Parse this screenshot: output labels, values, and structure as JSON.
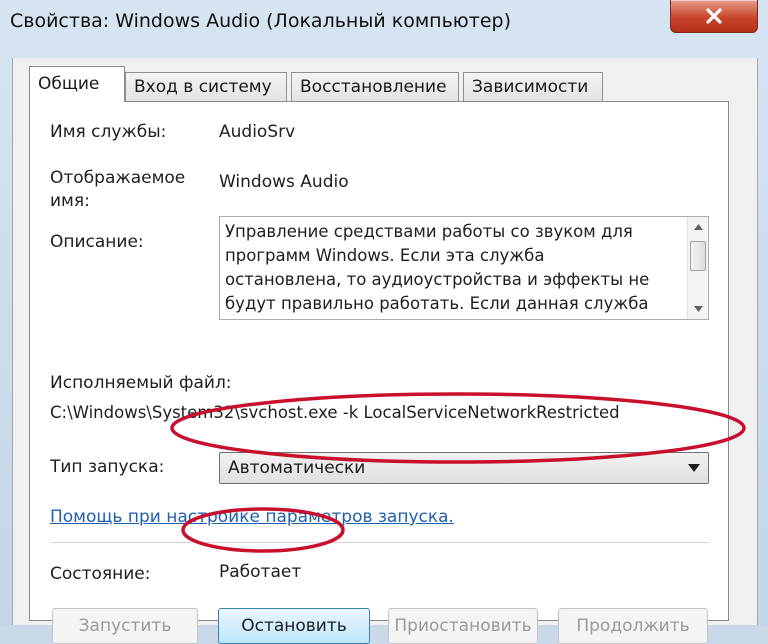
{
  "window": {
    "title": "Свойства: Windows Audio (Локальный компьютер)"
  },
  "tabs": [
    {
      "label": "Общие",
      "active": true
    },
    {
      "label": "Вход в систему",
      "active": false
    },
    {
      "label": "Восстановление",
      "active": false
    },
    {
      "label": "Зависимости",
      "active": false
    }
  ],
  "general": {
    "service_name_label": "Имя службы:",
    "service_name_value": "AudioSrv",
    "display_name_label_line1": "Отображаемое",
    "display_name_label_line2": "имя:",
    "display_name_value": "Windows Audio",
    "description_label": "Описание:",
    "description_lines": [
      "Управление средствами работы со звуком для",
      "программ Windows.  Если эта служба",
      "остановлена, то аудиоустройства и эффекты не",
      "будут правильно работать.  Если данная служба"
    ],
    "executable_label": "Исполняемый файл:",
    "executable_value": "C:\\Windows\\System32\\svchost.exe -k LocalServiceNetworkRestricted",
    "startup_type_label": "Тип запуска:",
    "startup_type_value": "Автоматически",
    "help_link": "Помощь при настройке параметров запуска.",
    "status_label": "Состояние:",
    "status_value": "Работает"
  },
  "buttons": {
    "start": "Запустить",
    "stop": "Остановить",
    "pause": "Приостановить",
    "resume": "Продолжить"
  },
  "colors": {
    "annotation": "#c8102e",
    "link": "#1f5fae"
  },
  "icons": {
    "close": "close-icon",
    "dropdown": "chevron-down-icon"
  }
}
